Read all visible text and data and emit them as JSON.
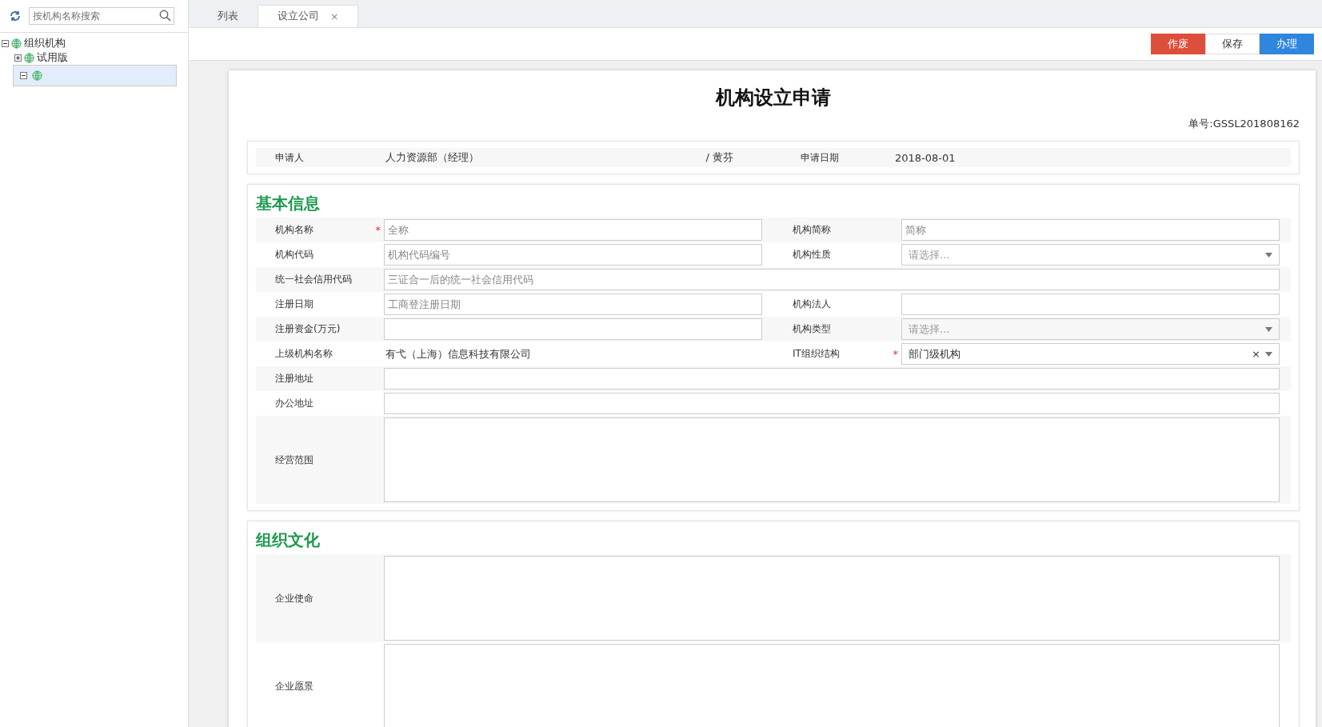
{
  "sidebar": {
    "search": {
      "placeholder": "按机构名称搜索"
    },
    "tree": [
      {
        "label": "组织机构",
        "expanded": true,
        "selected": false,
        "children": [
          {
            "label": "试用版",
            "expanded": false,
            "selected": false
          },
          {
            "expanded": true,
            "selected": true
          }
        ]
      }
    ]
  },
  "tabs": [
    {
      "label": "列表",
      "selected": false
    },
    {
      "label": "设立公司",
      "selected": true,
      "close": "×"
    }
  ],
  "toolbar": {
    "buttons": [
      {
        "label": "作废",
        "kind": "danger"
      },
      {
        "label": "保存",
        "kind": "default"
      },
      {
        "label": "办理",
        "kind": "primary"
      }
    ]
  },
  "form": {
    "title": "机构设立申请",
    "number": "单号:GSSL201808162",
    "applicant": {
      "label": "申请人",
      "department": "人力资源部（经理）",
      "name": "/ 黄芬",
      "date_label": "申请日期",
      "date": "2018-08-01"
    },
    "sections": [
      {
        "title": "基本信息",
        "rows": [
          {
            "fields": [
              {
                "label": "机构名称",
                "required_mark": "*",
                "kind": "input",
                "placeholder": "全称"
              },
              {
                "label": "机构简称",
                "kind": "input",
                "placeholder": "简称"
              }
            ]
          },
          {
            "fields": [
              {
                "label": "机构代码",
                "kind": "input",
                "placeholder": "机构代码编号"
              },
              {
                "label": "机构性质",
                "kind": "select",
                "placeholder": "请选择..."
              }
            ]
          },
          {
            "fields": [
              {
                "label": "统一社会信用代码",
                "kind": "input",
                "placeholder": "三证合一后的统一社会信用代码"
              }
            ]
          },
          {
            "fields": [
              {
                "label": "注册日期",
                "kind": "input",
                "placeholder": "工商登注册日期"
              },
              {
                "label": "机构法人",
                "kind": "input"
              }
            ]
          },
          {
            "fields": [
              {
                "label": "注册资金(万元)",
                "kind": "input"
              },
              {
                "label": "机构类型",
                "kind": "select",
                "placeholder": "请选择..."
              }
            ]
          },
          {
            "fields": [
              {
                "label": "上级机构名称",
                "kind": "text",
                "value": "有弋（上海）信息科技有限公司"
              },
              {
                "label": "IT组织结构",
                "required_mark": "*",
                "kind": "select",
                "value": "部门级机构",
                "clear": "×"
              }
            ]
          },
          {
            "fields": [
              {
                "label": "注册地址",
                "kind": "input"
              }
            ]
          },
          {
            "fields": [
              {
                "label": "办公地址",
                "kind": "input"
              }
            ]
          },
          {
            "fields": [
              {
                "label": "经营范围",
                "kind": "textarea"
              }
            ]
          }
        ]
      },
      {
        "title": "组织文化",
        "rows": [
          {
            "fields": [
              {
                "label": "企业使命",
                "kind": "textarea"
              }
            ]
          },
          {
            "fields": [
              {
                "label": "企业愿景",
                "kind": "textarea"
              }
            ]
          }
        ]
      }
    ]
  }
}
